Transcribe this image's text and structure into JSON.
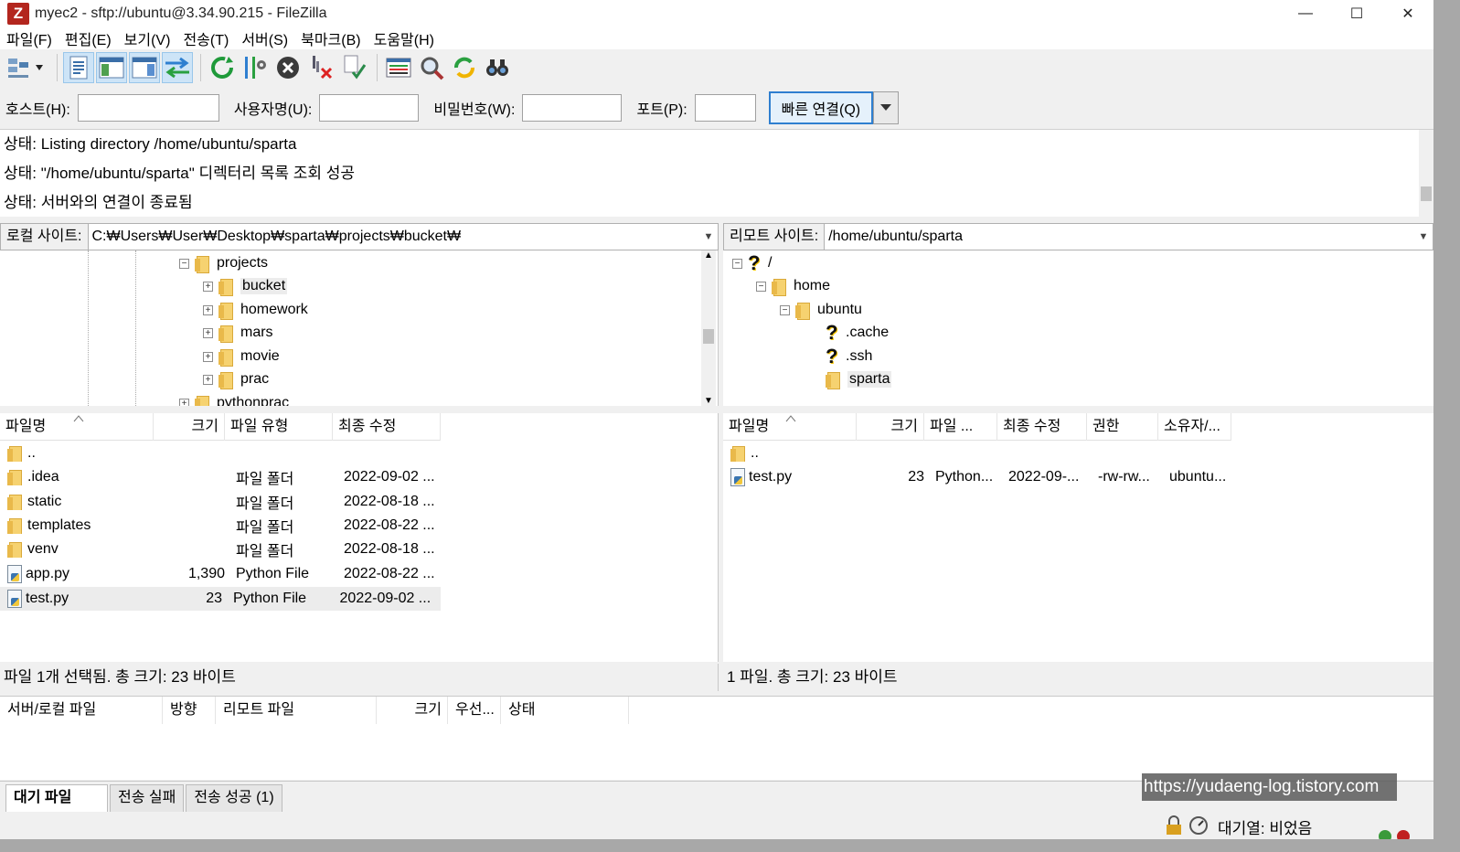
{
  "window": {
    "title": "myec2 - sftp://ubuntu@3.34.90.215 - FileZilla",
    "app_icon": "Z",
    "controls": [
      "—",
      "☐",
      "✕"
    ]
  },
  "menu": [
    "파일(F)",
    "편집(E)",
    "보기(V)",
    "전송(T)",
    "서버(S)",
    "북마크(B)",
    "도움말(H)"
  ],
  "toolbar": {
    "icons": [
      "site-manager-icon",
      "toggle-log-icon",
      "toggle-local-tree-icon",
      "toggle-remote-tree-icon",
      "toggle-queue-icon",
      "refresh-icon",
      "filter-icon",
      "cancel-icon",
      "disconnect-icon",
      "reconnect-icon",
      "directory-listing-icon",
      "search-icon",
      "sync-browse-icon",
      "binoculars-icon"
    ]
  },
  "quickconnect": {
    "host_label": "호스트(H):",
    "host_value": "",
    "user_label": "사용자명(U):",
    "user_value": "",
    "pass_label": "비밀번호(W):",
    "pass_value": "",
    "port_label": "포트(P):",
    "port_value": "",
    "connect_label": "빠른 연결(Q)"
  },
  "log": [
    {
      "prefix": "상태:",
      "text": "Listing directory /home/ubuntu/sparta"
    },
    {
      "prefix": "상태:",
      "text": "\"/home/ubuntu/sparta\" 디렉터리 목록 조회 성공"
    },
    {
      "prefix": "상태:",
      "text": "서버와의 연결이 종료됨"
    }
  ],
  "local": {
    "label": "로컬 사이트:",
    "path": "C:₩Users₩User₩Desktop₩sparta₩projects₩bucket₩",
    "tree": [
      "projects",
      "bucket",
      "homework",
      "mars",
      "movie",
      "prac",
      "pythonprac"
    ],
    "columns": [
      "파일명",
      "크기",
      "파일 유형",
      "최종 수정"
    ],
    "files": [
      {
        "name": "..",
        "size": "",
        "type": "",
        "modified": ""
      },
      {
        "name": ".idea",
        "size": "",
        "type": "파일 폴더",
        "modified": "2022-09-02 ..."
      },
      {
        "name": "static",
        "size": "",
        "type": "파일 폴더",
        "modified": "2022-08-18 ..."
      },
      {
        "name": "templates",
        "size": "",
        "type": "파일 폴더",
        "modified": "2022-08-22 ..."
      },
      {
        "name": "venv",
        "size": "",
        "type": "파일 폴더",
        "modified": "2022-08-18 ..."
      },
      {
        "name": "app.py",
        "size": "1,390",
        "type": "Python File",
        "modified": "2022-08-22 ..."
      },
      {
        "name": "test.py",
        "size": "23",
        "type": "Python File",
        "modified": "2022-09-02 ..."
      }
    ],
    "status": "파일 1개 선택됨. 총 크기: 23 바이트"
  },
  "remote": {
    "label": "리모트 사이트:",
    "path": "/home/ubuntu/sparta",
    "tree": [
      "/",
      "home",
      "ubuntu",
      ".cache",
      ".ssh",
      "sparta"
    ],
    "columns": [
      "파일명",
      "크기",
      "파일 ...",
      "최종 수정",
      "권한",
      "소유자/..."
    ],
    "files": [
      {
        "name": "..",
        "size": "",
        "type": "",
        "modified": "",
        "perm": "",
        "owner": ""
      },
      {
        "name": "test.py",
        "size": "23",
        "type": "Python...",
        "modified": "2022-09-...",
        "perm": "-rw-rw...",
        "owner": "ubuntu..."
      }
    ],
    "status": "1 파일. 총 크기: 23 바이트"
  },
  "queue": {
    "columns": [
      "서버/로컬 파일",
      "방향",
      "리모트 파일",
      "크기",
      "우선...",
      "상태"
    ]
  },
  "tabs": [
    "대기 파일",
    "전송 실패",
    "전송 성공 (1)"
  ],
  "statusbar": {
    "queue_text": "대기열: 비었음"
  },
  "watermark": "https://yudaeng-log.tistory.com",
  "colors": {
    "accent": "#2f7fd0",
    "selected_row": "#ececec",
    "folder": "#f6d270"
  }
}
